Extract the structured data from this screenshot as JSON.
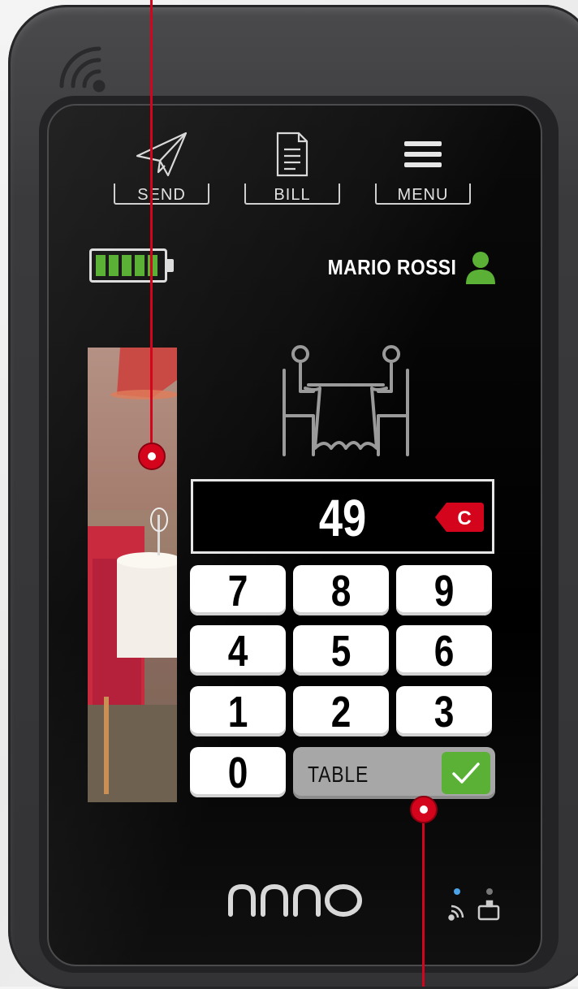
{
  "toolbar": {
    "send_label": "SEND",
    "bill_label": "BILL",
    "menu_label": "MENU",
    "send_icon": "paper-plane-icon",
    "bill_icon": "document-icon",
    "menu_icon": "hamburger-icon"
  },
  "battery": {
    "level_percent": 100,
    "icon": "battery-icon",
    "color": "#5ab135"
  },
  "user": {
    "name": "MARIO ROSSI",
    "icon": "user-icon",
    "icon_color": "#5ab135"
  },
  "table": {
    "icon": "dining-table-icon"
  },
  "display": {
    "value": "49",
    "clear_label": "C",
    "clear_color": "#d3041c"
  },
  "keypad": {
    "rows": [
      [
        "7",
        "8",
        "9"
      ],
      [
        "4",
        "5",
        "6"
      ],
      [
        "1",
        "2",
        "3"
      ]
    ],
    "zero": "0"
  },
  "confirm": {
    "label": "TABLE",
    "icon": "checkmark-icon",
    "check_color": "#5ab135"
  },
  "brand": {
    "logo_text": "nano"
  },
  "status_icons": [
    "rfid-icon",
    "card-slot-icon"
  ],
  "accent": "#d3041c"
}
